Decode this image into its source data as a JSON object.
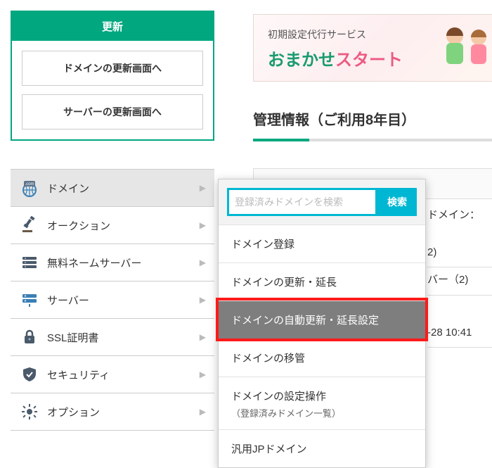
{
  "renew": {
    "title": "更新",
    "btn_domain": "ドメインの更新画面へ",
    "btn_server": "サーバーの更新画面へ"
  },
  "nav": {
    "items": [
      {
        "label": "ドメイン",
        "icon": "globe-com-icon"
      },
      {
        "label": "オークション",
        "icon": "gavel-icon"
      },
      {
        "label": "無料ネームサーバー",
        "icon": "server-stack-icon"
      },
      {
        "label": "サーバー",
        "icon": "server-icon"
      },
      {
        "label": "SSL証明書",
        "icon": "lock-icon"
      },
      {
        "label": "セキュリティ",
        "icon": "shield-icon"
      },
      {
        "label": "オプション",
        "icon": "gear-icon"
      }
    ]
  },
  "banner": {
    "sub": "初期設定代行サービス",
    "main_1": "おまかせ",
    "main_2": "スタート"
  },
  "info_header": "管理情報（ご利用8年目）",
  "flyout": {
    "search_placeholder": "登録済みドメインを検索",
    "search_btn": "検索",
    "items": [
      "ドメイン登録",
      "ドメインの更新・延長",
      "ドメインの自動更新・延長設定",
      "ドメインの移管",
      "ドメインの設定操作",
      "（登録済みドメイン一覧）",
      "汎用JPドメイン"
    ]
  },
  "peek": {
    "domain_label": "ドメイン：",
    "row1": "2)",
    "row2": "バー（2)",
    "row3": "-28 10:41"
  }
}
